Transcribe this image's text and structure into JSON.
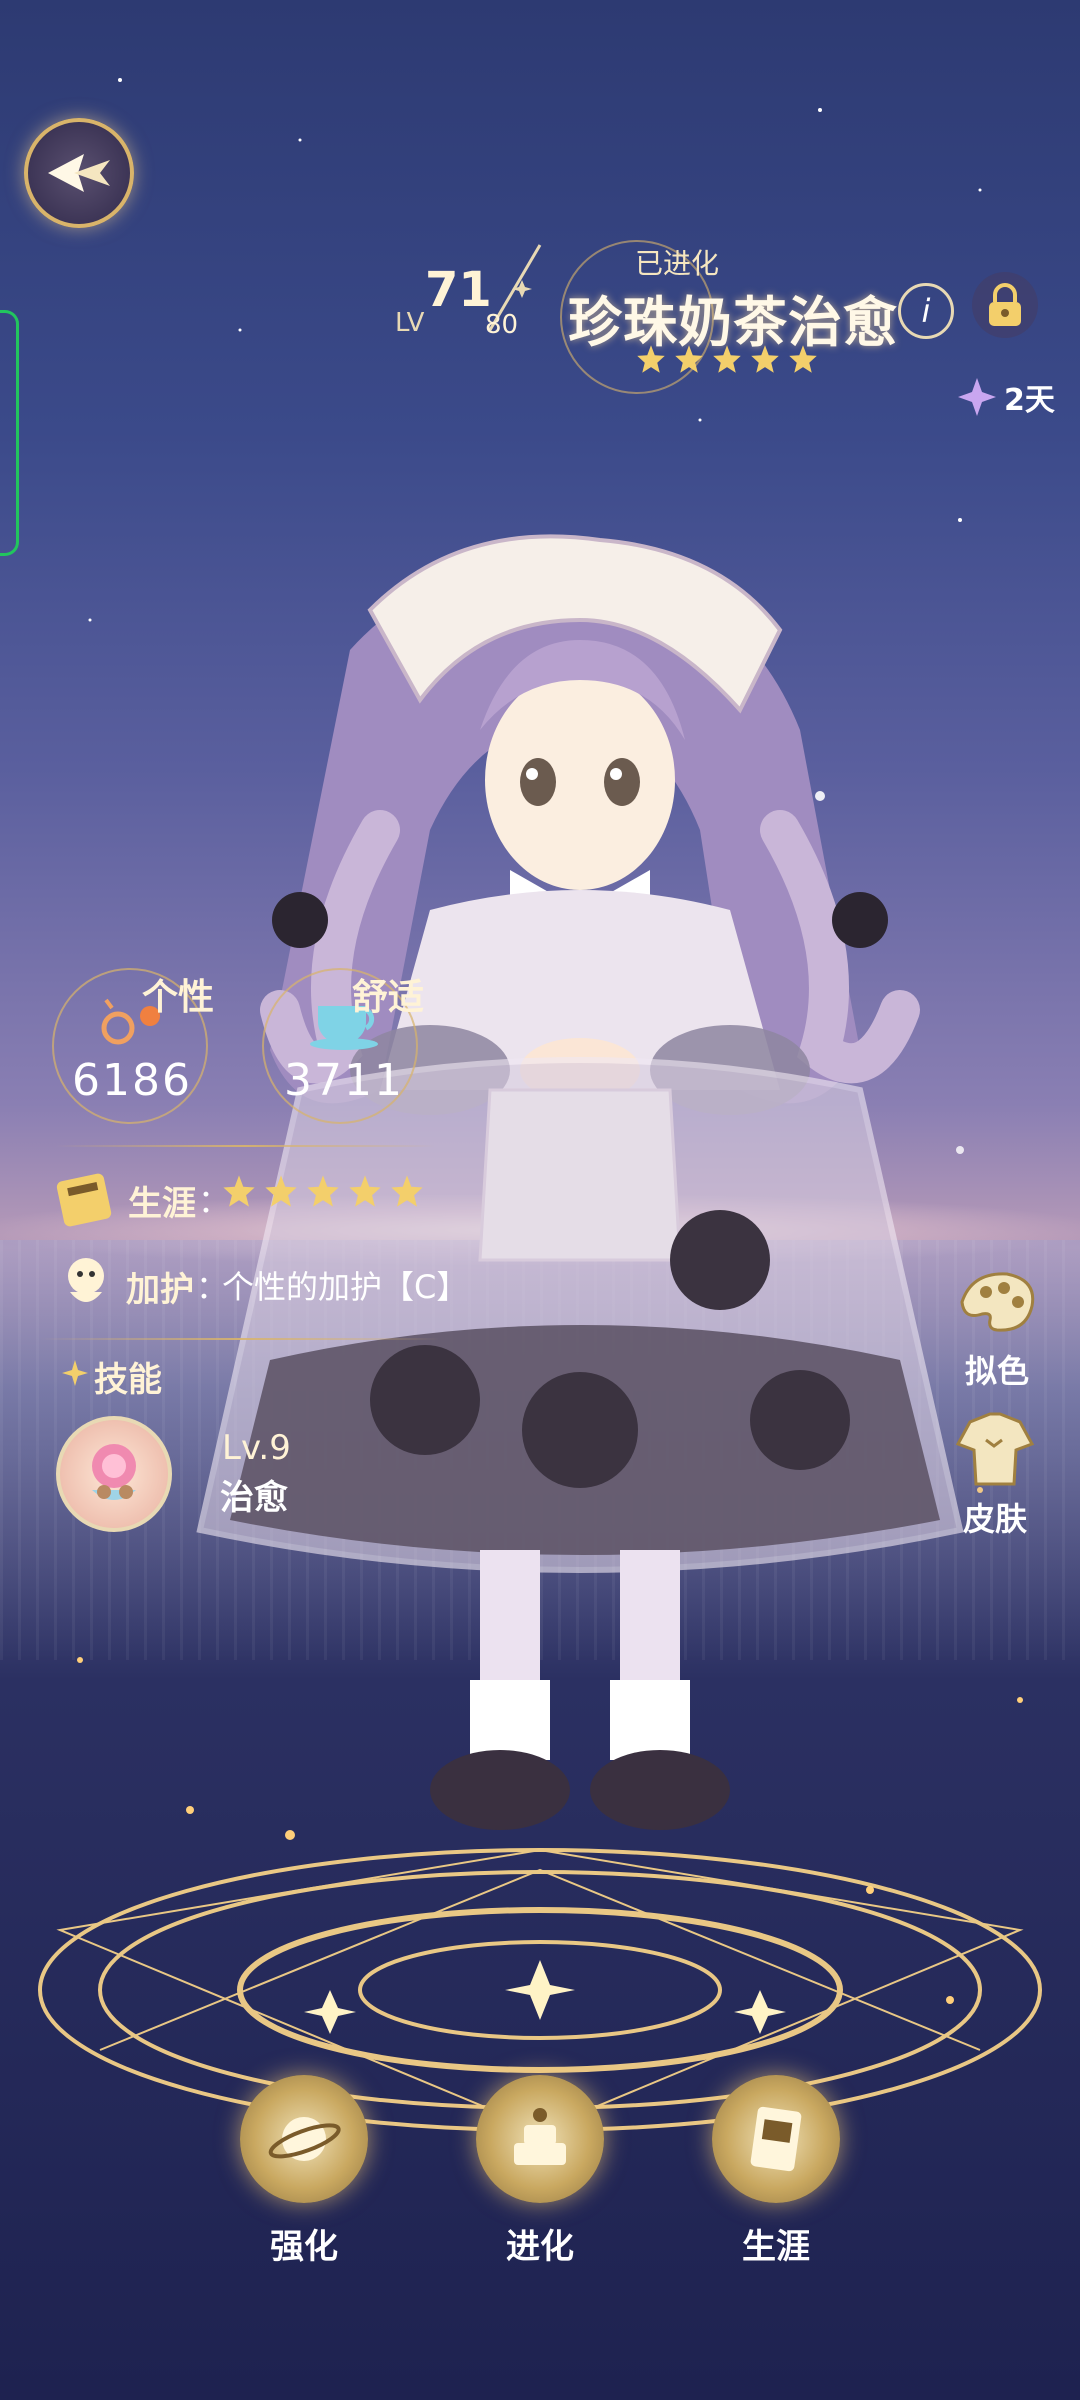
{
  "header": {
    "level_prefix": "LV",
    "level_current": "71",
    "level_max": "80",
    "status_tag": "已进化",
    "character_name": "珍珠奶茶治愈",
    "info_icon": "info-icon",
    "lock_icon": "lock-icon",
    "rarity_stars": 5,
    "timer_icon": "diamond-sparkle-icon",
    "timer_text": "2天"
  },
  "stats": {
    "personality": {
      "label": "个性",
      "value": "6186",
      "icon": "molecule-icon"
    },
    "comfort": {
      "label": "舒适",
      "value": "3711",
      "icon": "teacup-icon"
    }
  },
  "career": {
    "label": "生涯",
    "separator": "：",
    "stars": 5,
    "icon": "career-book-icon"
  },
  "blessing": {
    "label": "加护",
    "separator": "：",
    "value": "个性的加护【C】",
    "icon": "spirit-icon"
  },
  "skill": {
    "section_label": "技能",
    "level": "Lv.9",
    "name": "治愈",
    "icon": "healing-rose-icon"
  },
  "side_buttons": [
    {
      "label": "拟色",
      "icon": "palette-icon"
    },
    {
      "label": "皮肤",
      "icon": "skin-outfit-icon"
    }
  ],
  "bottom_buttons": [
    {
      "label": "强化",
      "icon": "planet-icon"
    },
    {
      "label": "进化",
      "icon": "evolve-cake-icon"
    },
    {
      "label": "生涯",
      "icon": "career-card-icon"
    }
  ],
  "colors": {
    "gold": "#d9b46a",
    "accent_green": "#22c55e",
    "star": "#f3cf6b"
  }
}
